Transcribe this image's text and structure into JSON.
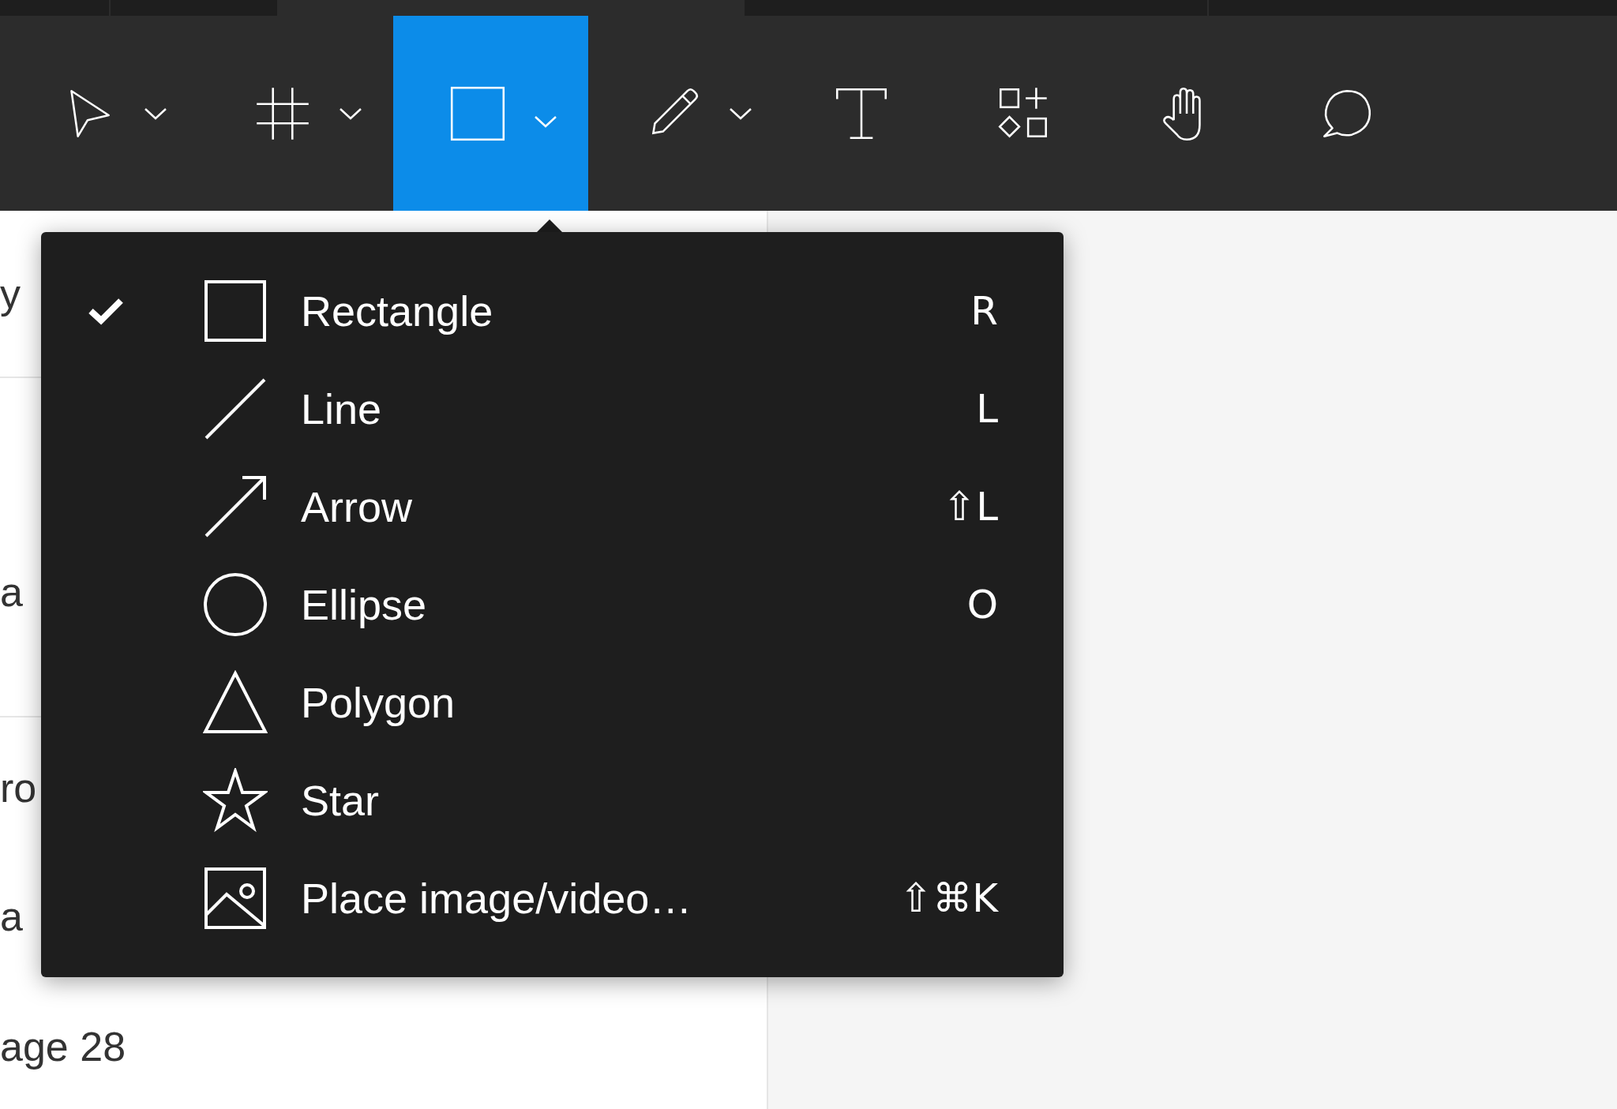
{
  "toolbar": {
    "tools": [
      {
        "kind": "move",
        "selected": false,
        "dropdown": true
      },
      {
        "kind": "frame",
        "selected": false,
        "dropdown": true
      },
      {
        "kind": "rectangle",
        "selected": true,
        "dropdown": true
      },
      {
        "kind": "pen",
        "selected": false,
        "dropdown": true
      },
      {
        "kind": "text",
        "selected": false,
        "dropdown": false
      },
      {
        "kind": "resources",
        "selected": false,
        "dropdown": false
      },
      {
        "kind": "hand",
        "selected": false,
        "dropdown": false
      },
      {
        "kind": "comment",
        "selected": false,
        "dropdown": false
      }
    ]
  },
  "layers_panel": {
    "items": [
      "y",
      "a",
      "ro",
      "a",
      "age 28"
    ]
  },
  "shape_menu": {
    "items": [
      {
        "kind": "rectangle",
        "label": "Rectangle",
        "shortcut": "R",
        "checked": true
      },
      {
        "kind": "line",
        "label": "Line",
        "shortcut": "L",
        "checked": false
      },
      {
        "kind": "arrow",
        "label": "Arrow",
        "shortcut": "⇧L",
        "checked": false
      },
      {
        "kind": "ellipse",
        "label": "Ellipse",
        "shortcut": "O",
        "checked": false
      },
      {
        "kind": "polygon",
        "label": "Polygon",
        "checked": false
      },
      {
        "kind": "star",
        "label": "Star",
        "checked": false
      },
      {
        "kind": "image",
        "label": "Place image/video…",
        "shortcut": "⇧⌘K",
        "checked": false
      }
    ]
  }
}
